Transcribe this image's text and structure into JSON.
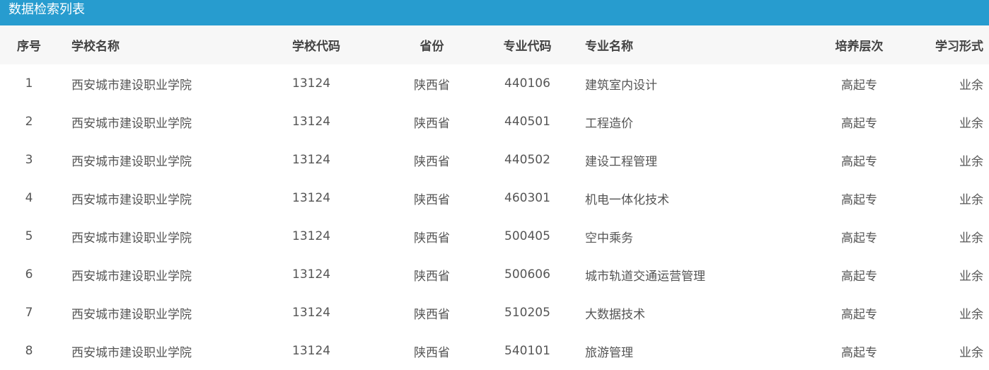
{
  "page": {
    "title": "数据检索列表"
  },
  "table": {
    "headers": [
      "序号",
      "学校名称",
      "学校代码",
      "省份",
      "专业代码",
      "专业名称",
      "培养层次",
      "学习形式"
    ],
    "rows": [
      [
        "1",
        "西安城市建设职业学院",
        "13124",
        "陕西省",
        "440106",
        "建筑室内设计",
        "高起专",
        "业余"
      ],
      [
        "2",
        "西安城市建设职业学院",
        "13124",
        "陕西省",
        "440501",
        "工程造价",
        "高起专",
        "业余"
      ],
      [
        "3",
        "西安城市建设职业学院",
        "13124",
        "陕西省",
        "440502",
        "建设工程管理",
        "高起专",
        "业余"
      ],
      [
        "4",
        "西安城市建设职业学院",
        "13124",
        "陕西省",
        "460301",
        "机电一体化技术",
        "高起专",
        "业余"
      ],
      [
        "5",
        "西安城市建设职业学院",
        "13124",
        "陕西省",
        "500405",
        "空中乘务",
        "高起专",
        "业余"
      ],
      [
        "6",
        "西安城市建设职业学院",
        "13124",
        "陕西省",
        "500606",
        "城市轨道交通运营管理",
        "高起专",
        "业余"
      ],
      [
        "7",
        "西安城市建设职业学院",
        "13124",
        "陕西省",
        "510205",
        "大数据技术",
        "高起专",
        "业余"
      ],
      [
        "8",
        "西安城市建设职业学院",
        "13124",
        "陕西省",
        "540101",
        "旅游管理",
        "高起专",
        "业余"
      ]
    ]
  },
  "colors": {
    "title_bar": "#279ccf",
    "header_bg": "#f7f7f7"
  }
}
